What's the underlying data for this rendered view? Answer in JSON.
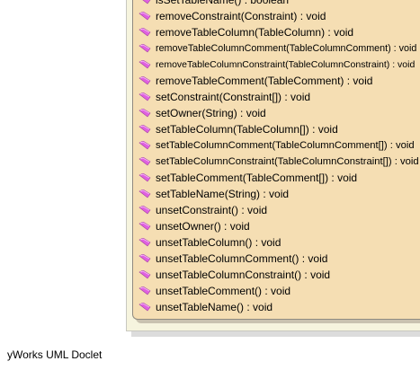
{
  "methods": [
    "isSetTableName() : boolean",
    "removeConstraint(Constraint) : void",
    "removeTableColumn(TableColumn) : void",
    "removeTableColumnComment(TableColumnComment) : void",
    "removeTableColumnConstraint(TableColumnConstraint) : void",
    "removeTableComment(TableComment) : void",
    "setConstraint(Constraint[]) : void",
    "setOwner(String) : void",
    "setTableColumn(TableColumn[]) : void",
    "setTableColumnComment(TableColumnComment[]) : void",
    "setTableColumnConstraint(TableColumnConstraint[]) : void",
    "setTableComment(TableComment[]) : void",
    "setTableName(String) : void",
    "unsetConstraint() : void",
    "unsetOwner() : void",
    "unsetTableColumn() : void",
    "unsetTableColumnComment() : void",
    "unsetTableColumnConstraint() : void",
    "unsetTableComment() : void",
    "unsetTableName() : void"
  ],
  "method_icon": "public-method-icon",
  "colors": {
    "class_fill": "#f5deb3",
    "icon": "#e060e0"
  },
  "footer": "yWorks UML Doclet"
}
